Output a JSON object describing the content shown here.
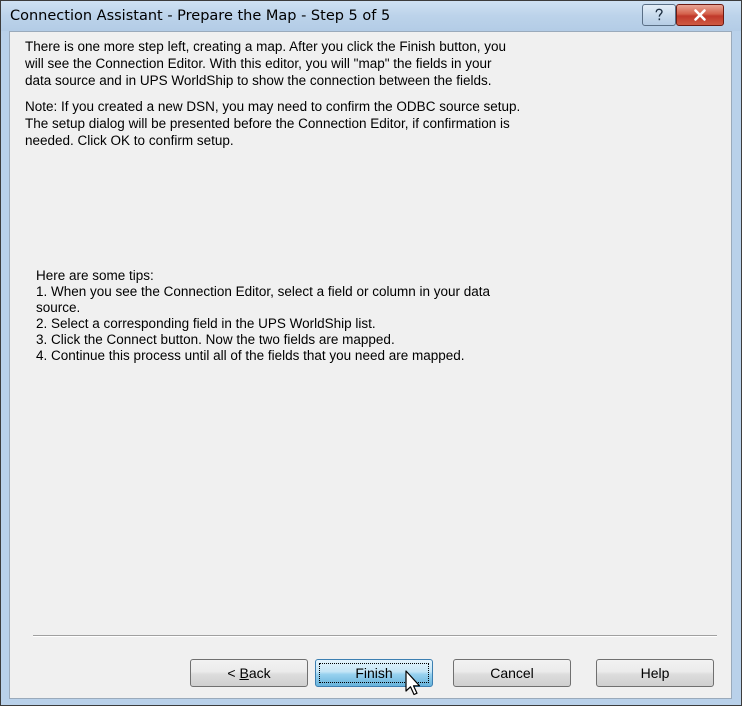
{
  "window": {
    "title": "Connection Assistant - Prepare the Map - Step 5 of 5",
    "help_glyph": "?",
    "close_glyph": "✕"
  },
  "content": {
    "paragraph1": "There is one more step left, creating a map. After you click the Finish button, you\nwill see the Connection Editor. With this editor, you will  \"map\" the fields in your\ndata source and in UPS WorldShip to show the connection between the fields.",
    "paragraph2": "Note: If you created a new DSN, you may need to confirm the ODBC source setup.\nThe setup dialog will be presented before the Connection Editor, if confirmation is\nneeded.  Click OK to confirm setup.",
    "tips_heading": "Here are some tips:",
    "tips": [
      "1. When you see the Connection Editor, select a field or column in your data",
      "source.",
      "2. Select a corresponding field in the  UPS WorldShip list.",
      "3. Click the Connect button. Now the two fields are mapped.",
      "4. Continue this process until all of the fields that you need are mapped."
    ]
  },
  "buttons": {
    "back_prefix": "< ",
    "back_mnemonic": "B",
    "back_rest": "ack",
    "finish": "Finish",
    "cancel": "Cancel",
    "help": "Help"
  },
  "icons": {
    "help": "question-mark-icon",
    "close": "close-x-icon",
    "cursor": "mouse-pointer-icon"
  },
  "colors": {
    "title_bar": "#b9d1ea",
    "close_button": "#c0392b",
    "dialog_background": "#f0f0f0",
    "default_button": "#98d1ef"
  }
}
